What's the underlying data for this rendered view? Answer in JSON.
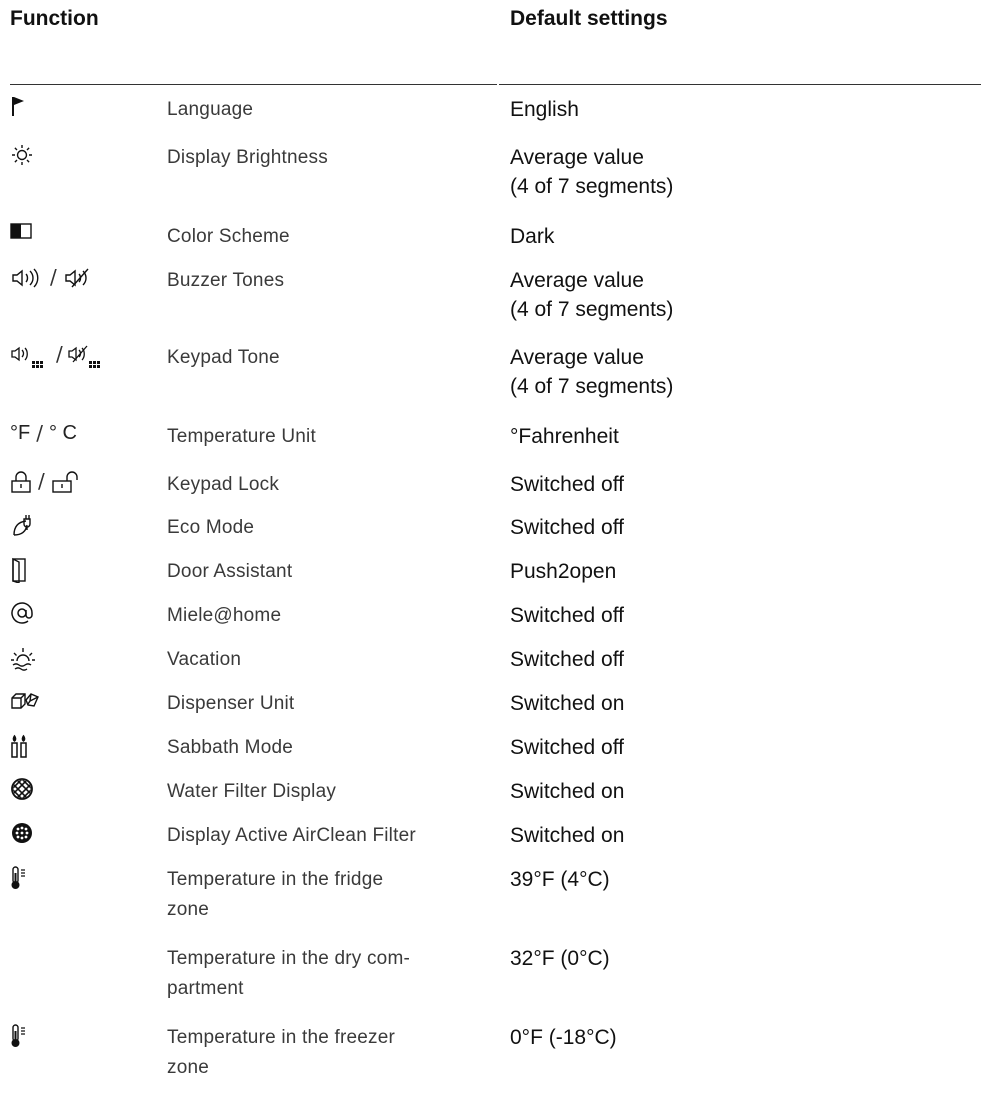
{
  "header": {
    "function_label": "Function",
    "default_label": "Default settings"
  },
  "rows": [
    {
      "icon": "flag-icon",
      "function": "Language",
      "default_lines": [
        "English"
      ]
    },
    {
      "icon": "sun-icon",
      "function": "Display Brightness",
      "default_lines": [
        "Average value",
        "(4 of 7 segments)"
      ]
    },
    {
      "icon": "color-scheme-icon",
      "function": "Color Scheme",
      "default_lines": [
        "Dark"
      ]
    },
    {
      "icon": "speaker-on-off-icon",
      "function": "Buzzer Tones",
      "default_lines": [
        "Average value",
        "(4 of 7 segments)"
      ]
    },
    {
      "icon": "keypad-speaker-on-off-icon",
      "function": "Keypad Tone",
      "default_lines": [
        "Average value",
        "(4 of 7 segments)"
      ]
    },
    {
      "icon": "temperature-unit-icon",
      "function": "Temperature Unit",
      "default_lines": [
        "°Fahrenheit"
      ],
      "icon_text_f": "°F",
      "icon_text_c": "° C"
    },
    {
      "icon": "lock-unlock-icon",
      "function": "Keypad Lock",
      "default_lines": [
        "Switched off"
      ]
    },
    {
      "icon": "eco-plug-icon",
      "function": "Eco Mode",
      "default_lines": [
        "Switched off"
      ]
    },
    {
      "icon": "door-icon",
      "function": "Door Assistant",
      "default_lines": [
        "Push2open"
      ]
    },
    {
      "icon": "at-icon",
      "function": "Miele@home",
      "default_lines": [
        "Switched off"
      ]
    },
    {
      "icon": "sunrise-icon",
      "function": "Vacation",
      "default_lines": [
        "Switched off"
      ]
    },
    {
      "icon": "ice-cubes-icon",
      "function": "Dispenser Unit",
      "default_lines": [
        "Switched on"
      ]
    },
    {
      "icon": "candles-icon",
      "function": "Sabbath Mode",
      "default_lines": [
        "Switched off"
      ]
    },
    {
      "icon": "water-filter-icon",
      "function": "Water Filter Display",
      "default_lines": [
        "Switched on"
      ]
    },
    {
      "icon": "airclean-filter-icon",
      "function": "Display Active AirClean Filter",
      "default_lines": [
        "Switched on"
      ]
    },
    {
      "icon": "thermometer-icon",
      "function_lines": [
        "Temperature in the fridge",
        "zone"
      ],
      "default_lines": [
        "39°F (4°C)"
      ]
    },
    {
      "icon": "",
      "function_lines": [
        "Temperature in the dry com-",
        "partment"
      ],
      "default_lines": [
        "32°F (0°C)"
      ]
    },
    {
      "icon": "thermometer-icon",
      "function_lines": [
        "Temperature in the freezer",
        "zone"
      ],
      "default_lines": [
        "0°F (-18°C)"
      ]
    }
  ]
}
